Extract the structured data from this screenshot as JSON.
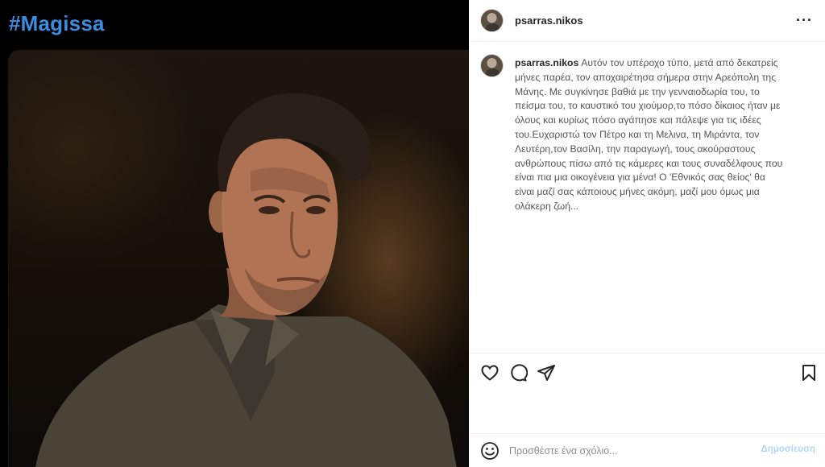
{
  "left": {
    "hashtag": "#Magissa"
  },
  "post": {
    "username": "psarras.nikos",
    "caption": "Αυτόν τον υπέροχο τύπο, μετά από δεκατρείς μήνες παρέα, τον αποχαιρέτησα σήμερα στην Αρεόπολη της Μάνης. Με συγκίνησε βαθιά με την γενναιοδωρία του, το πείσμα του, το καυστικό του χιούμορ,το πόσο δίκαιος ήταν με όλους και κυρίως πόσο αγάπησε και πάλεψε για τις ιδέες του.Ευχαριστώ τον Πέτρο και τη Μελινα, τη Μιράντα, τον Λευτέρη,τον Βασίλη, την παραγωγή, τους ακούραστους ανθρώπους πίσω από τις κάμερες και τους συναδέλφους που είναι πια μια οικογένεια για μένα! Ο 'Εθνικός σας θείος' θα είναι μαζί σας κάποιους μήνες ακόμη, μαζί μου όμως μια ολάκερη ζωή..."
  },
  "comment": {
    "placeholder": "Προσθέστε ένα σχόλιο...",
    "post_label": "Δημοσίευση"
  },
  "icons": {
    "more": "more-options-icon",
    "like": "heart-icon",
    "comment": "comment-icon",
    "share": "share-icon",
    "save": "bookmark-icon",
    "emoji": "emoji-icon"
  },
  "colors": {
    "hashtag": "#3d8ce0",
    "post_button_disabled": "#b3d6f8"
  }
}
